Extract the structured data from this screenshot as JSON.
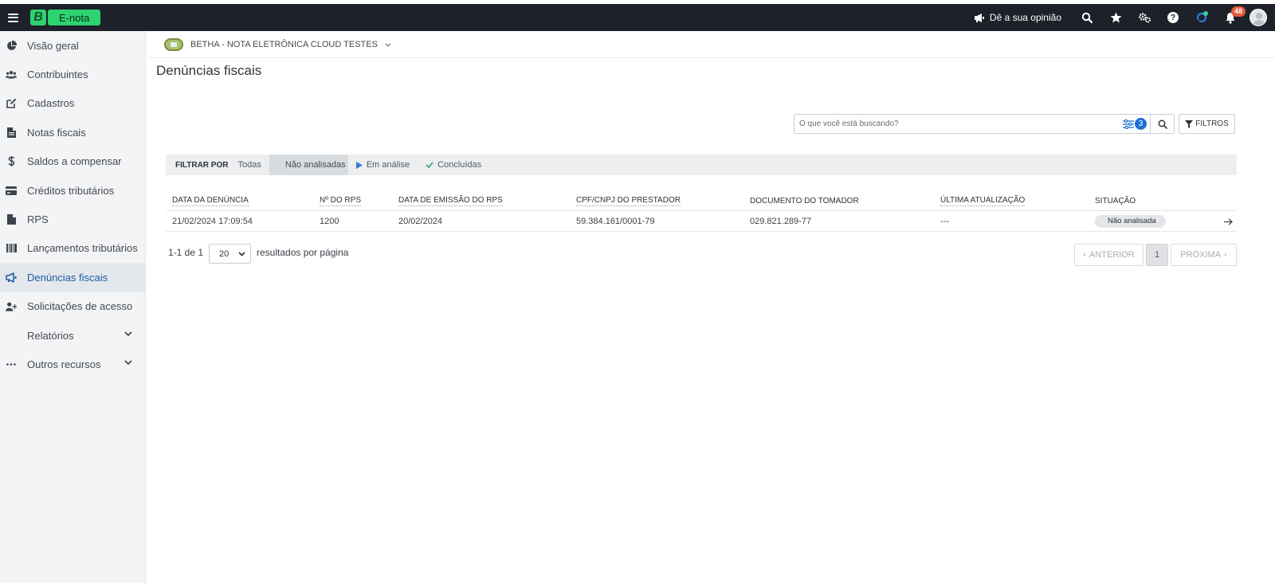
{
  "app": {
    "brand_letter": "B",
    "brand_name": "E-nota"
  },
  "topbar": {
    "feedback_label": "Dê a sua opinião",
    "notifications_count": "48",
    "help_label": "?"
  },
  "sidebar": {
    "items": [
      {
        "label": "Visão geral",
        "icon": "pie-chart-icon"
      },
      {
        "label": "Contribuintes",
        "icon": "users-icon"
      },
      {
        "label": "Cadastros",
        "icon": "edit-icon"
      },
      {
        "label": "Notas fiscais",
        "icon": "file-icon"
      },
      {
        "label": "Saldos a compensar",
        "icon": "dollar-icon"
      },
      {
        "label": "Créditos tributários",
        "icon": "credit-card-icon"
      },
      {
        "label": "RPS",
        "icon": "file-icon"
      },
      {
        "label": "Lançamentos tributários",
        "icon": "barcode-icon"
      },
      {
        "label": "Denúncias fiscais",
        "icon": "megaphone-icon"
      },
      {
        "label": "Solicitações de acesso",
        "icon": "user-plus-icon"
      },
      {
        "label": "Relatórios",
        "icon": ""
      },
      {
        "label": "Outros recursos",
        "icon": "ellipsis-icon"
      }
    ],
    "active_index": 8
  },
  "entity": {
    "name": "BETHA - NOTA ELETRÔNICA CLOUD TESTES"
  },
  "page": {
    "title": "Denúncias fiscais"
  },
  "search": {
    "placeholder": "O que você está buscando?",
    "filter_count": "3",
    "filters_label": "FILTROS"
  },
  "filter_bar": {
    "label": "FILTRAR POR",
    "options": [
      "Todas",
      "Não analisadas",
      "Em análise",
      "Concluídas"
    ],
    "active": "Não analisadas"
  },
  "table": {
    "columns": [
      "DATA DA DENÚNCIA",
      "Nº DO RPS",
      "DATA DE EMISSÃO DO RPS",
      "CPF/CNPJ DO PRESTADOR",
      "DOCUMENTO DO TOMADOR",
      "ÚLTIMA ATUALIZAÇÃO",
      "SITUAÇÃO"
    ],
    "rows": [
      {
        "data_denuncia": "21/02/2024 17:09:54",
        "numero_rps": "1200",
        "data_emissao": "20/02/2024",
        "cpf_cnpj_prestador": "59.384.161/0001-79",
        "documento_tomador": "029.821.289-77",
        "ultima_atualizacao": "---",
        "situacao": "Não analisada"
      }
    ]
  },
  "pagination": {
    "results": "1-1 de 1",
    "per_page": "20",
    "per_page_label": "resultados por página",
    "prev_label": "ANTERIOR",
    "current_page": "1",
    "next_label": "PRÓXIMA"
  },
  "colors": {
    "topbar_bg": "#1d2129",
    "brand_green": "#2dd36f",
    "active_link": "#1d5fa6",
    "badge_blue": "#1d6fd6",
    "notif_red": "#e25c3c"
  }
}
